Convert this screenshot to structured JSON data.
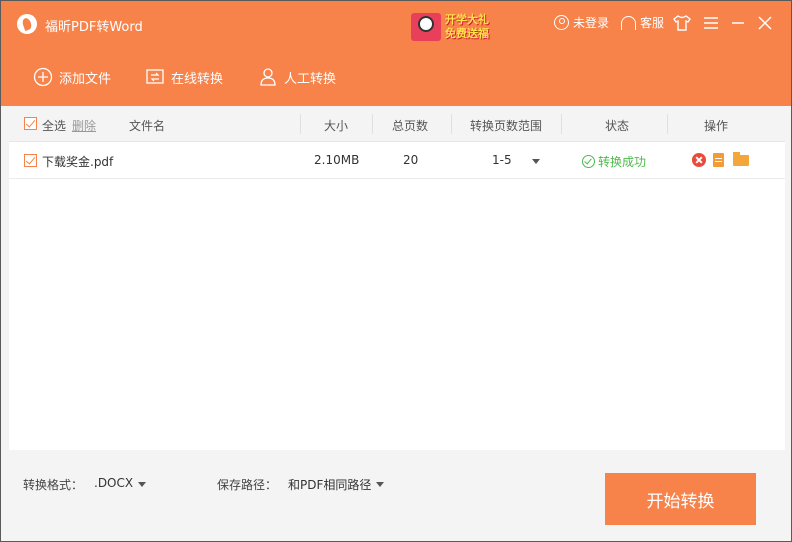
{
  "app": {
    "title": "福昕PDF转Word",
    "promo_line1": "开学大礼",
    "promo_line2": "免费送福",
    "login_label": "未登录",
    "service_label": "客服"
  },
  "toolbar": {
    "add_file": "添加文件",
    "online_convert": "在线转换",
    "manual_convert": "人工转换"
  },
  "list": {
    "header": {
      "select_all": "全选",
      "delete": "删除",
      "filename": "文件名",
      "size": "大小",
      "total_pages": "总页数",
      "page_range": "转换页数范围",
      "status": "状态",
      "actions": "操作"
    },
    "rows": [
      {
        "filename": "下载奖金.pdf",
        "size": "2.10MB",
        "total_pages": "20",
        "page_range": "1-5",
        "status": "转换成功"
      }
    ]
  },
  "bottom": {
    "format_label": "转换格式：",
    "format_value": ".DOCX",
    "path_label": "保存路径：",
    "path_value": "和PDF相同路径",
    "start_button": "开始转换"
  },
  "colors": {
    "accent": "#f7834b",
    "success": "#4cba4c",
    "delete_red": "#e84a3b"
  },
  "icons": [
    "app-logo-icon",
    "promo-envelope-icon",
    "user-icon",
    "headset-icon",
    "shirt-icon",
    "menu-icon",
    "minimize-icon",
    "close-icon",
    "add-file-icon",
    "online-convert-icon",
    "manual-convert-icon",
    "checkbox-icon",
    "success-icon",
    "delete-icon",
    "document-icon",
    "folder-icon",
    "chevron-down-icon"
  ]
}
